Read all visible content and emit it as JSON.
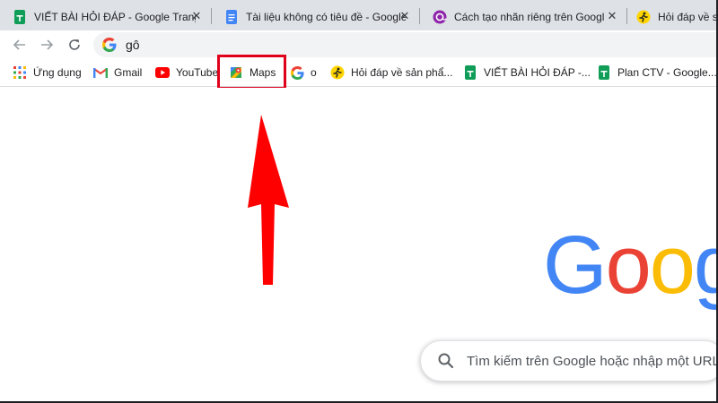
{
  "tabs": [
    {
      "title": "VIẾT BÀI HỎI ĐÁP - Google Trang tính",
      "icon": "google-sheets-icon"
    },
    {
      "title": "Tài liệu không có tiêu đề - Google Tài liệu",
      "icon": "google-docs-icon"
    },
    {
      "title": "Cách tạo nhãn riêng trên Google Maps",
      "icon": "at-sign-icon"
    },
    {
      "title": "Hỏi đáp về sản phẩm",
      "icon": "runner-icon"
    }
  ],
  "omnibox": {
    "text": "gô"
  },
  "bookmarks": [
    {
      "label": "Ứng dụng",
      "icon": "apps-grid-icon"
    },
    {
      "label": "Gmail",
      "icon": "gmail-icon"
    },
    {
      "label": "YouTube",
      "icon": "youtube-icon"
    },
    {
      "label": "Maps",
      "icon": "google-maps-icon"
    },
    {
      "label": "o",
      "icon": "google-g-icon"
    },
    {
      "label": "Hỏi đáp về sản phẩ...",
      "icon": "runner-icon"
    },
    {
      "label": "VIẾT BÀI HỎI ĐÁP -...",
      "icon": "google-sheets-icon"
    },
    {
      "label": "Plan CTV - Google...",
      "icon": "google-sheets-icon"
    }
  ],
  "google_logo": [
    "G",
    "o",
    "o",
    "g"
  ],
  "search": {
    "placeholder": "Tìm kiếm trên Google hoặc nhập một URL"
  },
  "colors": {
    "highlight": "#e0001b",
    "arrow": "#ff0000",
    "google_blue": "#4285f4",
    "google_red": "#ea4335",
    "google_yellow": "#fbbc05",
    "google_green": "#34a853"
  }
}
